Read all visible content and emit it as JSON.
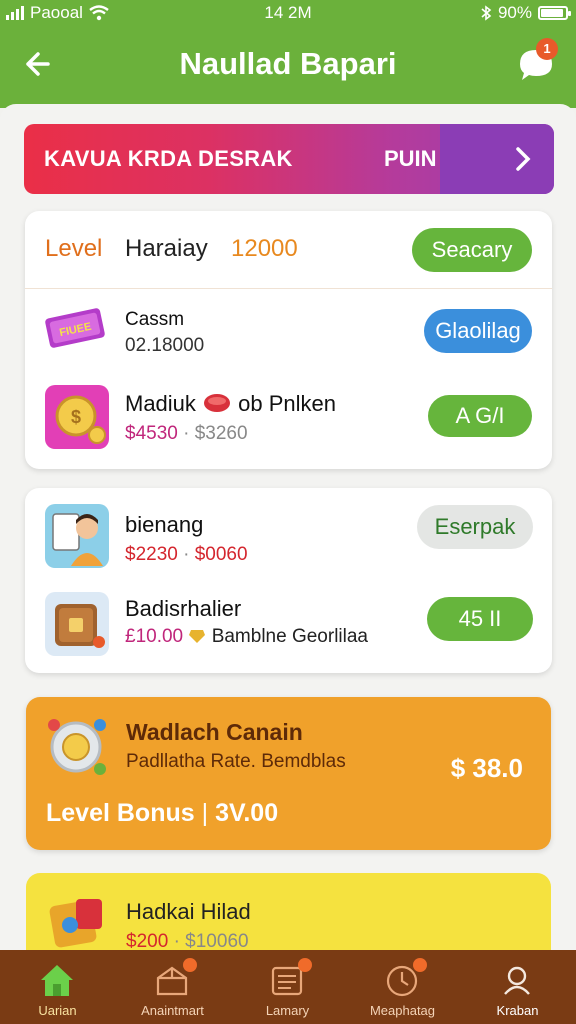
{
  "status": {
    "carrier": "Paooal",
    "time": "14 2M",
    "battery": "90%"
  },
  "appbar": {
    "title": "Naullad Bapari",
    "chat_badge": "1"
  },
  "promo": {
    "text": "KAVUA KRDA DESRAK",
    "action": "PUIN"
  },
  "card1": {
    "level": {
      "label": "Level",
      "name": "Haraiay",
      "points": "12000",
      "button": "Seacary"
    },
    "items": [
      {
        "name": "Cassm",
        "sub": "02.18000",
        "button": "Glaolilag"
      },
      {
        "name": "Madiuk",
        "name2": "ob Pnlken",
        "price": "$4530",
        "sep": "·",
        "price2": "$3260",
        "button": "A G/I"
      }
    ]
  },
  "card2": {
    "items": [
      {
        "name": "bienang",
        "price": "$2230",
        "sep": "·",
        "price2": "$0060",
        "button": "Eserpak"
      },
      {
        "name": "Badisrhalier",
        "price": "£10.00",
        "note": "Bamblne Georlilaa",
        "button": "45 II"
      }
    ]
  },
  "orange": {
    "title": "Wadlach Canain",
    "sub": "Padllatha Rate. Bemdblas",
    "amount": "$ 38.0",
    "bonus_label": "Level  Bonus",
    "bonus_value": "3V.00"
  },
  "yellow": {
    "title": "Hadkai Hilad",
    "price": "$200",
    "sep": "·",
    "price2": "$10060"
  },
  "tabs": [
    {
      "label": "Uarian",
      "icon": "home-icon"
    },
    {
      "label": "Anaintmart",
      "icon": "box-icon"
    },
    {
      "label": "Lamary",
      "icon": "list-icon"
    },
    {
      "label": "Meaphatag",
      "icon": "clock-icon"
    },
    {
      "label": "Kraban",
      "icon": "profile-icon"
    }
  ],
  "colors": {
    "header": "#6bb13b",
    "tabbar": "#7a3b14",
    "accent_green": "#66b53c",
    "accent_blue": "#3b8fdc",
    "orange": "#f0a12b",
    "yellow": "#f5e23f"
  }
}
